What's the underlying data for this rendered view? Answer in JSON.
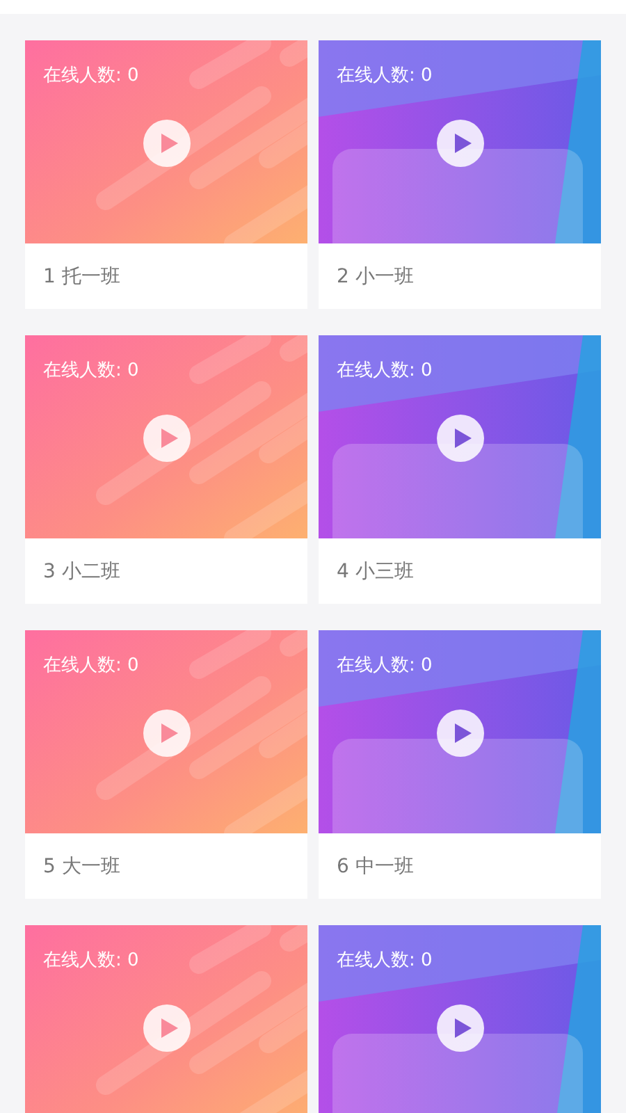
{
  "classes": [
    {
      "kind": "pink",
      "online": "在线人数: 0",
      "title": "1 托一班"
    },
    {
      "kind": "purple",
      "online": "在线人数: 0",
      "title": "2 小一班"
    },
    {
      "kind": "pink",
      "online": "在线人数: 0",
      "title": "3 小二班"
    },
    {
      "kind": "purple",
      "online": "在线人数: 0",
      "title": "4 小三班"
    },
    {
      "kind": "pink",
      "online": "在线人数: 0",
      "title": "5 大一班"
    },
    {
      "kind": "purple",
      "online": "在线人数: 0",
      "title": "6 中一班"
    },
    {
      "kind": "pink",
      "online": "在线人数: 0"
    },
    {
      "kind": "purple",
      "online": "在线人数: 0"
    }
  ]
}
